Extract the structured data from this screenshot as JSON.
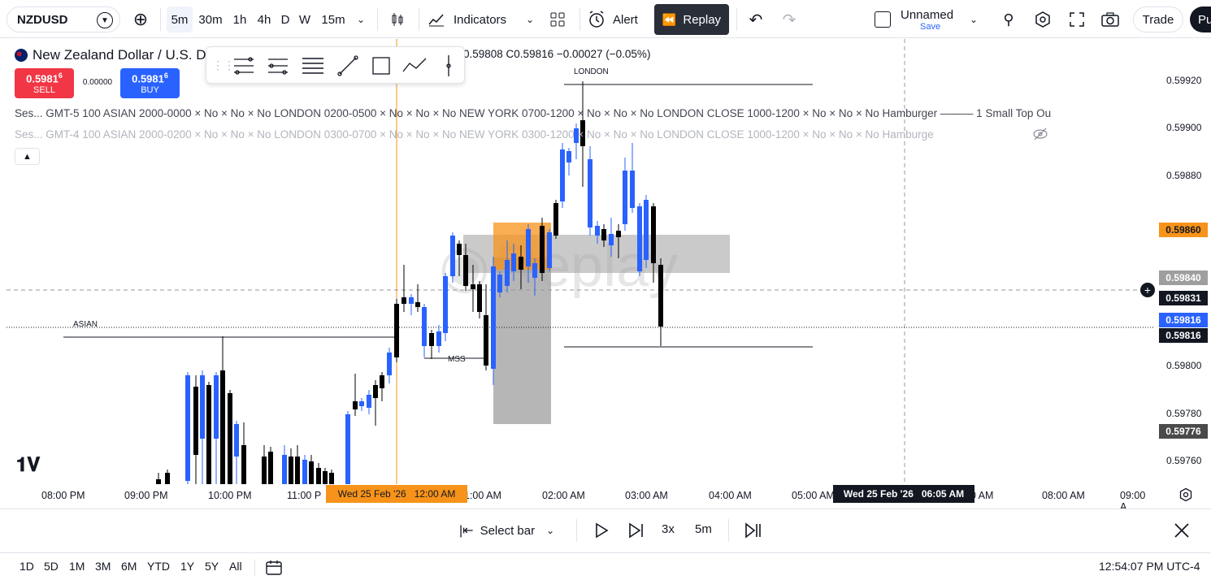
{
  "toolbar": {
    "symbol": "NZDUSD",
    "intervals": [
      "5m",
      "30m",
      "1h",
      "4h",
      "D",
      "W",
      "15m"
    ],
    "indicators_label": "Indicators",
    "alert_label": "Alert",
    "replay_label": "Replay",
    "layout_name": "Unnamed",
    "layout_save": "Save",
    "trade_label": "Trade",
    "publish_label": "Pu"
  },
  "legend": {
    "title": "New Zealand Dollar / U.S. D",
    "ohlc": "0.59808  C0.59816  −0.00027 (−0.05%)",
    "sell_price": "0.5981",
    "sell_super": "6",
    "sell_label": "SELL",
    "spread": "0.00000",
    "buy_price": "0.5981",
    "buy_super": "6",
    "buy_label": "BUY",
    "sessions1": "Ses...  GMT-5 100 ASIAN 2000-0000 × No × No × No LONDON 0200-0500 × No × No × No NEW YORK 0700-1200 × No × No × No LONDON CLOSE 1000-1200 × No × No × No Hamburger ——— 1 Small Top Ou",
    "sessions2": "Ses...  GMT-4 100 ASIAN 2000-0200 × No × No × No LONDON 0300-0700 × No × No × No NEW YORK 0300-1200 × No × No × No LONDON CLOSE 1000-1200 × No × No × No Hamburge"
  },
  "annotations": {
    "asian": "ASIAN",
    "london": "LONDON",
    "mss": "MSS",
    "watermark": "Replay"
  },
  "price_axis": {
    "ticks": [
      "0.59920",
      "0.59900",
      "0.59880",
      "0.59800",
      "0.59780",
      "0.59760"
    ],
    "tags": [
      {
        "value": "0.59860",
        "color": "#f7931a"
      },
      {
        "value": "0.59840",
        "color": "#9e9e9e"
      },
      {
        "value": "0.59831",
        "color": "#131722"
      },
      {
        "value": "0.59816",
        "color": "#2962ff"
      },
      {
        "value": "0.59816",
        "color": "#131722"
      },
      {
        "value": "0.59776",
        "color": "#4a4a4a"
      }
    ]
  },
  "time_axis": {
    "ticks": [
      "08:00 PM",
      "09:00 PM",
      "10:00 PM",
      "11:00 P",
      "1:00 AM",
      "02:00 AM",
      "03:00 AM",
      "04:00 AM",
      "05:00 AM",
      "00 AM",
      "08:00 AM",
      "09:00 A"
    ],
    "replay_start": "Wed 25 Feb '26   12:00 AM",
    "crosshair_time": "Wed 25 Feb '26   06:05 AM"
  },
  "replay_controls": {
    "select_bar": "Select bar",
    "speed": "3x",
    "interval": "5m"
  },
  "ranges": [
    "1D",
    "5D",
    "1M",
    "3M",
    "6M",
    "YTD",
    "1Y",
    "5Y",
    "All"
  ],
  "clock": "12:54:07 PM UTC-4",
  "colors": {
    "up": "#2962ff",
    "down": "#000000",
    "accent": "#f7931a"
  }
}
